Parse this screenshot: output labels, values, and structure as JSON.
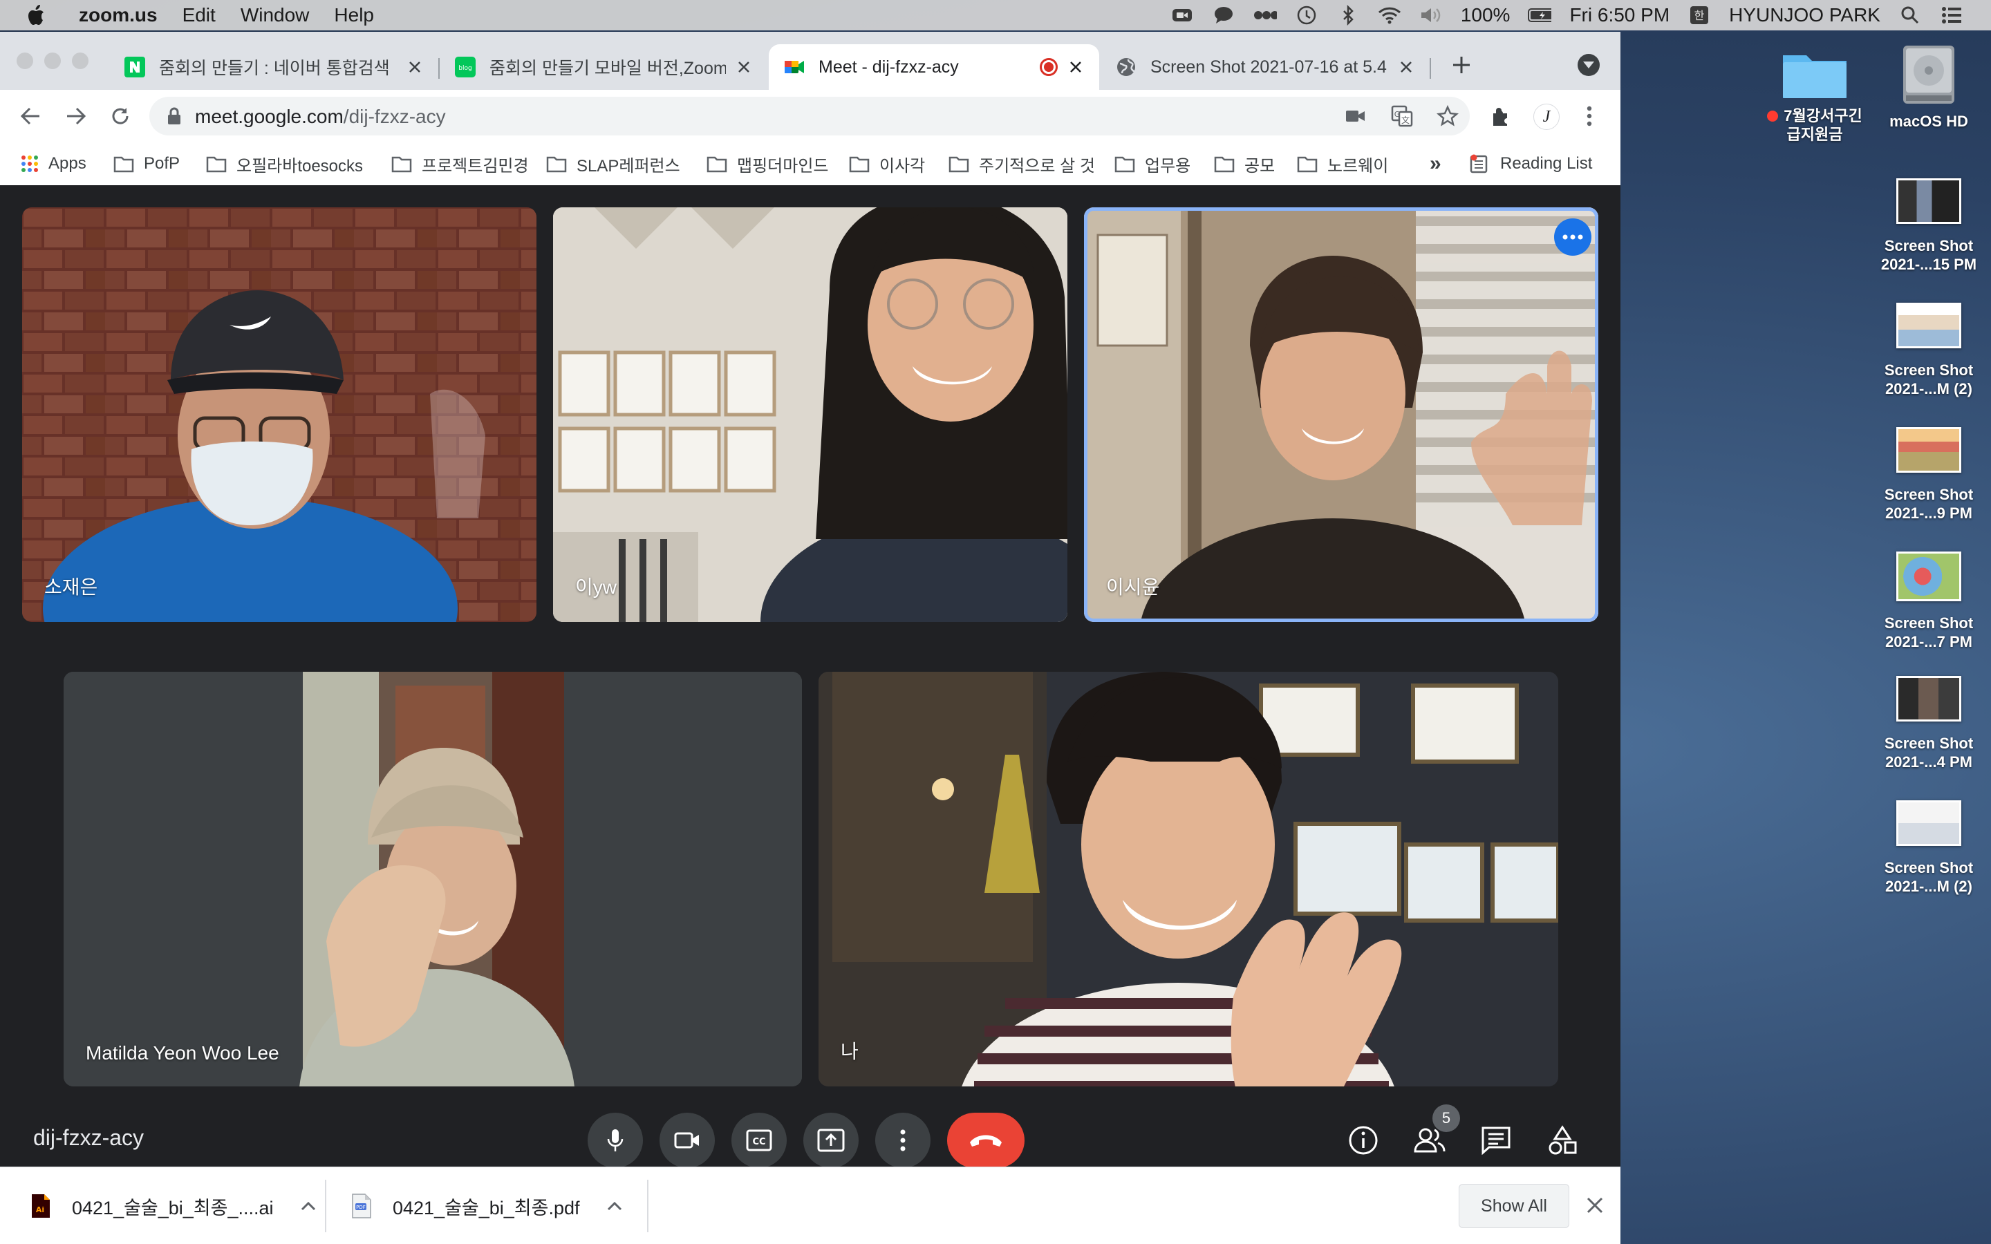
{
  "menubar": {
    "app_name": "zoom.us",
    "menus": [
      "Edit",
      "Window",
      "Help"
    ],
    "battery": "100%",
    "clock": "Fri 6:50 PM",
    "user": "HYUNJOO PARK"
  },
  "tabs": [
    {
      "title": "줌회의 만들기 : 네이버 통합검색",
      "icon": "naver-icon",
      "active": false
    },
    {
      "title": "줌회의 만들기 모바일 버전,Zoom회",
      "icon": "blog-icon",
      "active": false
    },
    {
      "title": "Meet - dij-fzxz-acy",
      "icon": "meet-icon",
      "active": true,
      "recording": true
    },
    {
      "title": "Screen Shot 2021-07-16 at 5.4",
      "icon": "globe-icon",
      "active": false
    }
  ],
  "address_bar": {
    "host": "meet.google.com",
    "path": "/dij-fzxz-acy"
  },
  "profile_initial": "J",
  "bookmarks": {
    "apps": "Apps",
    "folders": [
      "PofP",
      "오필라바toesocks",
      "프로젝트김민경",
      "SLAP레퍼런스",
      "맵핑더마인드",
      "이사각",
      "주기적으로 살 것",
      "업무용",
      "공모",
      "노르웨이"
    ],
    "overflow": "»",
    "reading_list": "Reading List"
  },
  "meeting": {
    "code": "dij-fzxz-acy",
    "participants": [
      {
        "name": "소재은"
      },
      {
        "name": "이yw"
      },
      {
        "name": "이시윤",
        "active_speaker": true
      },
      {
        "name": "Matilda Yeon Woo Lee"
      },
      {
        "name": "나"
      }
    ],
    "people_count": "5",
    "accent": "#8ab4f8",
    "end_call_color": "#ea4335"
  },
  "downloads": {
    "items": [
      {
        "name": "0421_술술_bi_최종_....ai",
        "icon": "ai-file-icon"
      },
      {
        "name": "0421_술술_bi_최종.pdf",
        "icon": "pdf-file-icon"
      }
    ],
    "show_all": "Show All"
  },
  "desktop": {
    "folder": {
      "name_line1": "7월강서구긴",
      "name_line2": "급지원금"
    },
    "drive": {
      "name": "macOS HD"
    },
    "screenshots": [
      {
        "line1": "Screen Shot",
        "line2": "2021-...15 PM"
      },
      {
        "line1": "Screen Shot",
        "line2": "2021-...M (2)"
      },
      {
        "line1": "Screen Shot",
        "line2": "2021-...9 PM"
      },
      {
        "line1": "Screen Shot",
        "line2": "2021-...7 PM"
      },
      {
        "line1": "Screen Shot",
        "line2": "2021-...4 PM"
      },
      {
        "line1": "Screen Shot",
        "line2": "2021-...M (2)"
      }
    ]
  }
}
